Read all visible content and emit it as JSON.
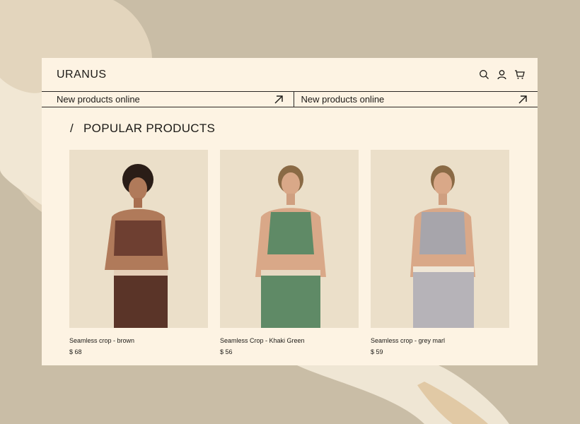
{
  "brand": "URANUS",
  "header_icons": [
    "search-icon",
    "user-icon",
    "cart-icon"
  ],
  "ticker": [
    {
      "label": "New products online",
      "icon": "arrow-up-right-icon"
    },
    {
      "label": "New products online",
      "icon": "arrow-up-right-icon"
    }
  ],
  "section": {
    "slash": "/",
    "title": "POPULAR PRODUCTS"
  },
  "products": [
    {
      "name": "Seamless crop - brown",
      "price": "$ 68",
      "color": "#6e3f31"
    },
    {
      "name": "Seamless Crop - Khaki Green",
      "price": "$ 56",
      "color": "#5f8a66"
    },
    {
      "name": "Seamless crop - grey marl",
      "price": "$ 59",
      "color": "#a7a5ab"
    }
  ]
}
